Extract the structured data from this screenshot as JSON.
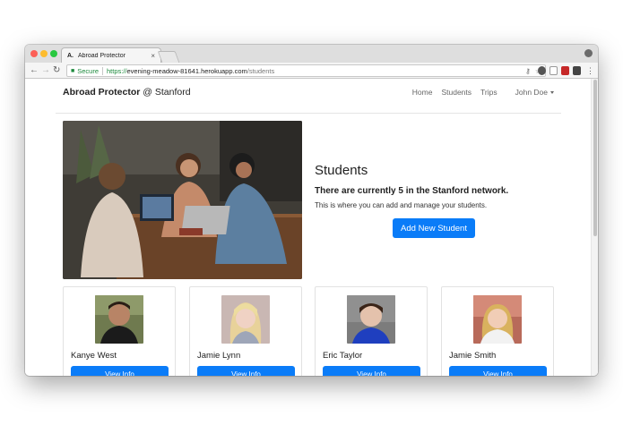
{
  "browser": {
    "tab_favicon": "A.",
    "tab_title": "Abroad Protector",
    "tab_close": "×",
    "url_secure_label": "Secure",
    "url_scheme": "https://",
    "url_host": "evening-meadow-81641.herokuapp.com",
    "url_path": "/students"
  },
  "navbar": {
    "brand_name": "Abroad Protector",
    "brand_suffix": "@ Stanford",
    "links": [
      "Home",
      "Students",
      "Trips"
    ],
    "user_menu": "John Doe"
  },
  "hero": {
    "heading": "Students",
    "subheading": "There are currently 5 in the Stanford network.",
    "text": "This is where you can add and manage your students.",
    "add_button": "Add New Student"
  },
  "students": [
    {
      "name": "Kanye West",
      "button": "View Info"
    },
    {
      "name": "Jamie Lynn",
      "button": "View Info"
    },
    {
      "name": "Eric Taylor",
      "button": "View Info"
    },
    {
      "name": "Jamie Smith",
      "button": "View Info"
    }
  ],
  "colors": {
    "primary": "#0a7cf8",
    "secure_green": "#1d8a3d",
    "text_dark": "#222222",
    "nav_text": "#666666"
  },
  "icons": [
    "back-icon",
    "forward-icon",
    "reload-icon",
    "lock-icon",
    "key-icon",
    "star-icon",
    "profile-icon",
    "more-menu-icon"
  ]
}
